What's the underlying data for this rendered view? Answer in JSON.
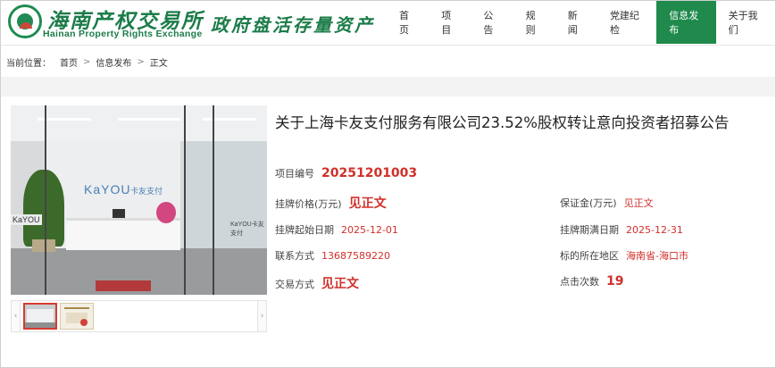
{
  "header": {
    "logo_name": "海南产权交易所",
    "logo_en": "Hainan Property Rights Exchange",
    "slogan": "政府盘活存量资产",
    "nav": [
      "首页",
      "项目",
      "公告",
      "规则",
      "新闻",
      "党建纪检",
      "信息发布",
      "关于我们"
    ],
    "nav_active": "信息发布"
  },
  "breadcrumb": {
    "prefix": "当前位置：",
    "items": [
      "首页",
      "信息发布",
      "正文"
    ]
  },
  "gallery": {
    "photo_brand": "KaYOU",
    "photo_brand_sub": "卡友支付",
    "photo_sign": "KaYOU",
    "photo_sign2": "KaYOU卡友支付",
    "prev_icon": "‹",
    "next_icon": "›"
  },
  "project": {
    "title": "关于上海卡友支付服务有限公司23.52%股权转让意向投资者招募公告",
    "code_label": "项目编号",
    "code": "20251201003",
    "price_label": "挂牌价格(万元)",
    "price": "见正文",
    "deposit_label": "保证金(万元)",
    "deposit": "见正文",
    "start_label": "挂牌起始日期",
    "start": "2025-12-01",
    "end_label": "挂牌期满日期",
    "end": "2025-12-31",
    "contact_label": "联系方式",
    "contact": "13687589220",
    "location_label": "标的所在地区",
    "location": "海南省-海口市",
    "method_label": "交易方式",
    "method": "见正文",
    "clicks_label": "点击次数",
    "clicks": "19"
  },
  "colors": {
    "brand_green": "#1f8a4c",
    "value_red": "#d0302a"
  }
}
